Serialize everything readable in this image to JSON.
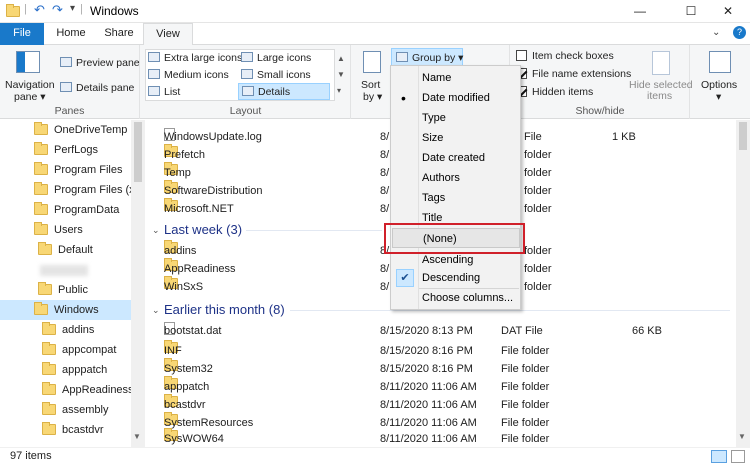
{
  "window": {
    "title": "Windows",
    "minimize": "—",
    "maximize": "☐",
    "close": "✕"
  },
  "ribbon_tabs": {
    "file": "File",
    "home": "Home",
    "share": "Share",
    "view": "View"
  },
  "panes": {
    "nav_pane": "Navigation",
    "nav_pane2": "pane ▾",
    "preview": "Preview pane",
    "details": "Details pane",
    "label": "Panes"
  },
  "layout": {
    "xl": "Extra large icons",
    "large": "Large icons",
    "medium": "Medium icons",
    "small": "Small icons",
    "list": "List",
    "details": "Details",
    "label": "Layout"
  },
  "current_view": {
    "sort": "Sort",
    "sort2": "by ▾",
    "group_by": "Group by ▾"
  },
  "showhide": {
    "item_cb": "Item check boxes",
    "ext": "File name extensions",
    "hidden": "Hidden items",
    "hide_sel": "Hide selected",
    "hide_sel2": "items",
    "label": "Show/hide"
  },
  "options": {
    "label": "Options",
    "label2": "▾"
  },
  "nav_items": [
    "OneDriveTemp",
    "PerfLogs",
    "Program Files",
    "Program Files (x86)",
    "ProgramData",
    "Users",
    "Default",
    "",
    "Public",
    "Windows",
    "addins",
    "appcompat",
    "apppatch",
    "AppReadiness",
    "assembly",
    "bcastdvr"
  ],
  "files_top": [
    {
      "name": "WindowsUpdate.log",
      "date": "8/",
      "type": "File",
      "size": "1 KB",
      "kind": "file"
    },
    {
      "name": "Prefetch",
      "date": "8/",
      "type": "folder",
      "size": "",
      "kind": "folder"
    },
    {
      "name": "Temp",
      "date": "8/",
      "type": "folder",
      "size": "",
      "kind": "folder"
    },
    {
      "name": "SoftwareDistribution",
      "date": "8/",
      "type": "folder",
      "size": "",
      "kind": "folder"
    },
    {
      "name": "Microsoft.NET",
      "date": "8/",
      "type": "folder",
      "size": "",
      "kind": "folder"
    }
  ],
  "group_last_week": "Last week (3)",
  "files_week": [
    {
      "name": "addins",
      "date": "8/",
      "type": "folder"
    },
    {
      "name": "AppReadiness",
      "date": "8/",
      "type": "folder"
    },
    {
      "name": "WinSxS",
      "date": "8/",
      "type": "folder"
    }
  ],
  "group_month": "Earlier this month (8)",
  "files_month": [
    {
      "name": "bootstat.dat",
      "date": "8/15/2020 8:13 PM",
      "type": "DAT File",
      "size": "66 KB",
      "kind": "file"
    },
    {
      "name": "INF",
      "date": "8/15/2020 8:16 PM",
      "type": "File folder",
      "size": "",
      "kind": "folder"
    },
    {
      "name": "System32",
      "date": "8/15/2020 8:16 PM",
      "type": "File folder",
      "size": "",
      "kind": "folder"
    },
    {
      "name": "apppatch",
      "date": "8/11/2020 11:06 AM",
      "type": "File folder",
      "size": "",
      "kind": "folder"
    },
    {
      "name": "bcastdvr",
      "date": "8/11/2020 11:06 AM",
      "type": "File folder",
      "size": "",
      "kind": "folder"
    },
    {
      "name": "SystemResources",
      "date": "8/11/2020 11:06 AM",
      "type": "File folder",
      "size": "",
      "kind": "folder"
    },
    {
      "name": "SysWOW64",
      "date": "8/11/2020 11:06 AM",
      "type": "File folder",
      "size": "",
      "kind": "folder"
    }
  ],
  "menu": {
    "items": [
      "Name",
      "Date modified",
      "Type",
      "Size",
      "Date created",
      "Authors",
      "Tags",
      "Title",
      "(None)",
      "Ascending",
      "Descending",
      "Choose columns..."
    ],
    "bullet": "•",
    "check": "✔"
  },
  "status": {
    "count": "97 items"
  },
  "colors": {
    "accent": "#1979ca",
    "highlight": "#d0202a",
    "selection": "#cce8ff"
  }
}
